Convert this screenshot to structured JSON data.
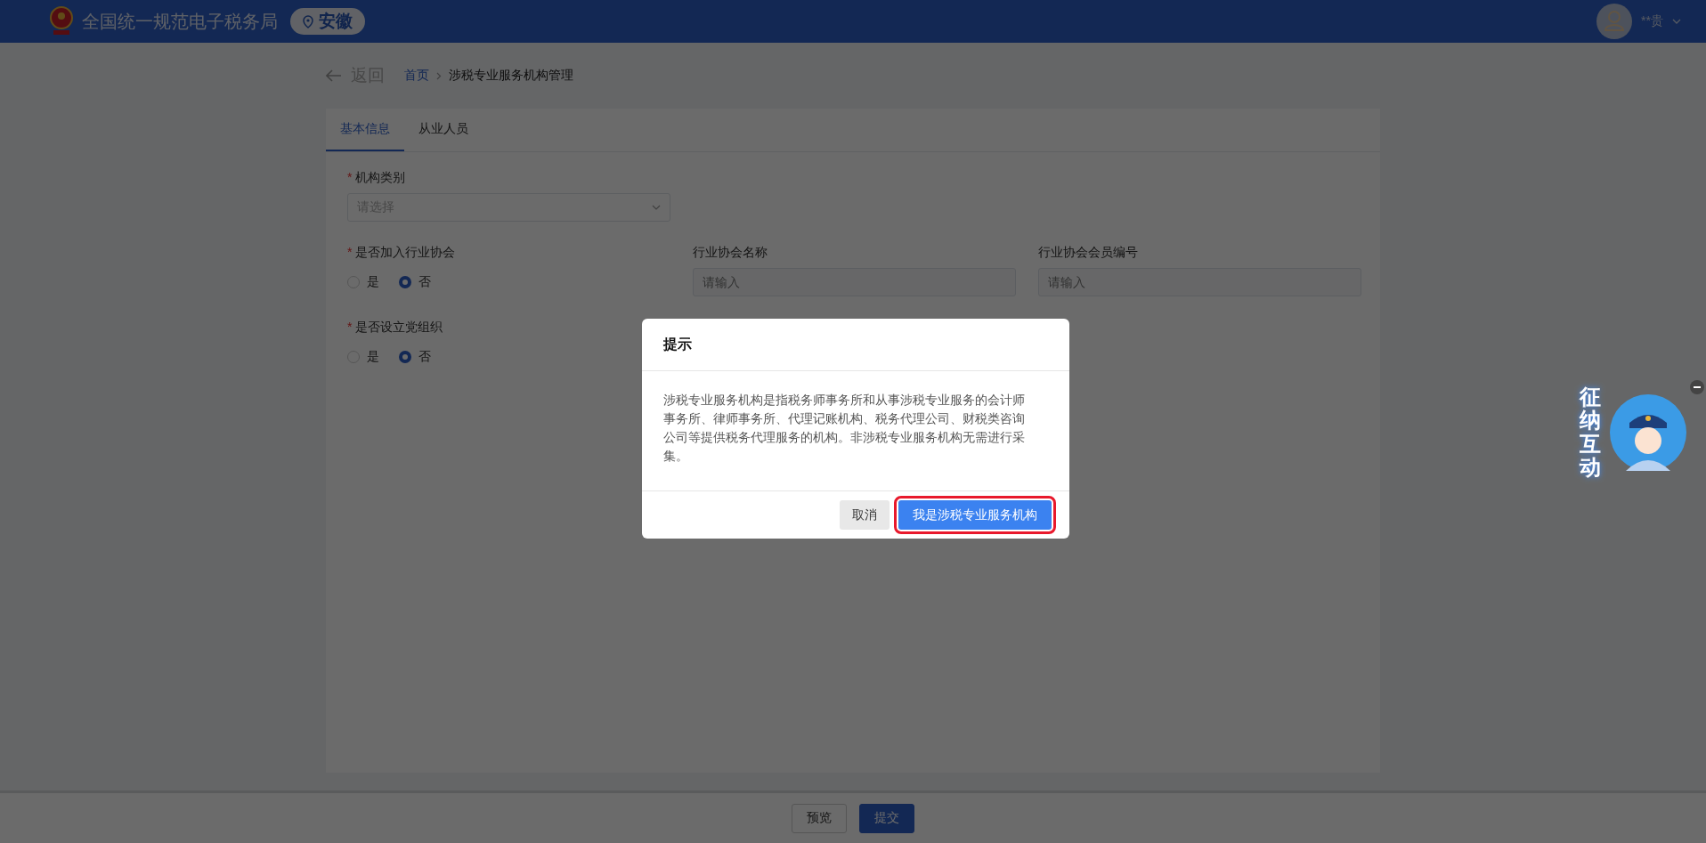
{
  "header": {
    "title": "全国统一规范电子税务局",
    "region": "安徽",
    "user_name": "**贵"
  },
  "breadcrumb": {
    "back": "返回",
    "items": [
      "首页",
      "涉税专业服务机构管理"
    ]
  },
  "tabs": [
    {
      "label": "基本信息",
      "selected": true
    },
    {
      "label": "从业人员",
      "selected": false
    }
  ],
  "form": {
    "rows": [
      [
        {
          "kind": "select",
          "label": "机构类别",
          "required_mark": "*",
          "placeholder": "请选择"
        }
      ],
      [
        {
          "kind": "radio",
          "label": "是否加入行业协会",
          "required_mark": "*",
          "options": [
            {
              "label": "是",
              "selected": false
            },
            {
              "label": "否",
              "selected": true
            }
          ]
        },
        {
          "kind": "input",
          "label": "行业协会名称",
          "placeholder": "请输入"
        },
        {
          "kind": "input",
          "label": "行业协会会员编号",
          "placeholder": "请输入"
        }
      ],
      [
        {
          "kind": "radio",
          "label": "是否设立党组织",
          "required_mark": "*",
          "options": [
            {
              "label": "是",
              "selected": false
            },
            {
              "label": "否",
              "selected": true
            }
          ]
        }
      ]
    ]
  },
  "footer_buttons": [
    {
      "label": "预览",
      "kind": "default"
    },
    {
      "label": "提交",
      "kind": "primary"
    }
  ],
  "modal": {
    "title": "提示",
    "message": "涉税专业服务机构是指税务师事务所和从事涉税专业服务的会计师事务所、律师事务所、代理记账机构、税务代理公司、财税类咨询公司等提供税务代理服务的机构。非涉税专业服务机构无需进行采集。",
    "buttons": [
      {
        "label": "取消",
        "kind": "default",
        "highlighted": false
      },
      {
        "label": "我是涉税专业服务机构",
        "kind": "primary",
        "highlighted": true
      }
    ]
  },
  "mascot": {
    "label": "征纳互动"
  }
}
